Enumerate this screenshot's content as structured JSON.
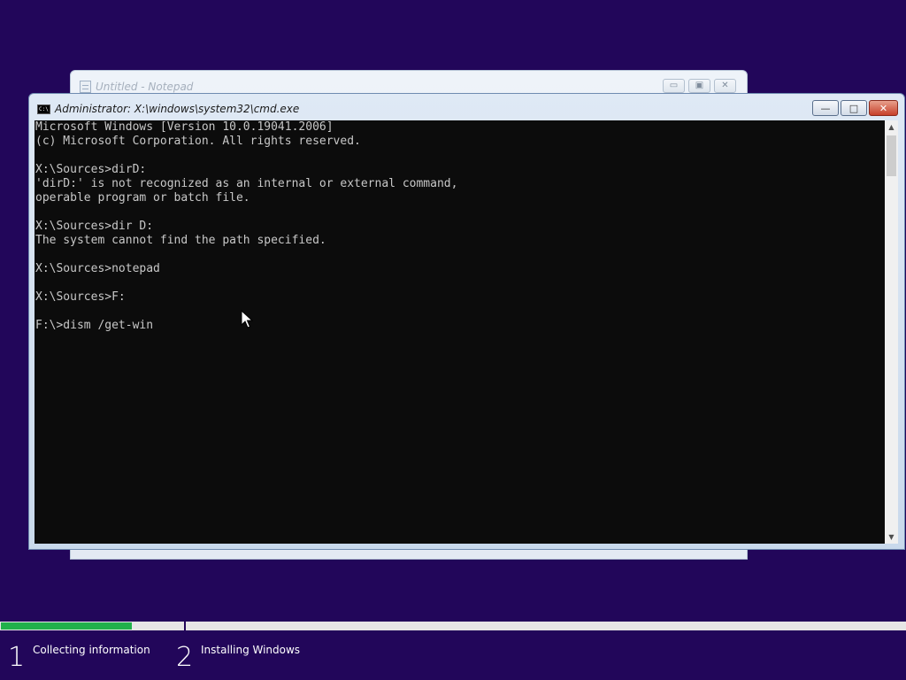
{
  "notepad": {
    "title": "Untitled - Notepad",
    "buttons": {
      "minimize": "▭",
      "maximize": "▣",
      "close": "✕"
    }
  },
  "cmd": {
    "title": "Administrator: X:\\windows\\system32\\cmd.exe",
    "icon_text": "C:\\",
    "buttons": {
      "minimize": "—",
      "maximize": "□",
      "close": "✕"
    },
    "lines": [
      "Microsoft Windows [Version 10.0.19041.2006]",
      "(c) Microsoft Corporation. All rights reserved.",
      "",
      "X:\\Sources>dirD:",
      "'dirD:' is not recognized as an internal or external command,",
      "operable program or batch file.",
      "",
      "X:\\Sources>dir D:",
      "The system cannot find the path specified.",
      "",
      "X:\\Sources>notepad",
      "",
      "X:\\Sources>F:",
      "",
      "F:\\>dism /get-win"
    ],
    "colors": {
      "background": "#0c0c0c",
      "text": "#c8c8c8"
    }
  },
  "setup": {
    "progress": 0.145,
    "progress_color": "#21b14b",
    "background": "#22065a",
    "steps": [
      {
        "number": "1",
        "label": "Collecting information"
      },
      {
        "number": "2",
        "label": "Installing Windows"
      }
    ]
  }
}
